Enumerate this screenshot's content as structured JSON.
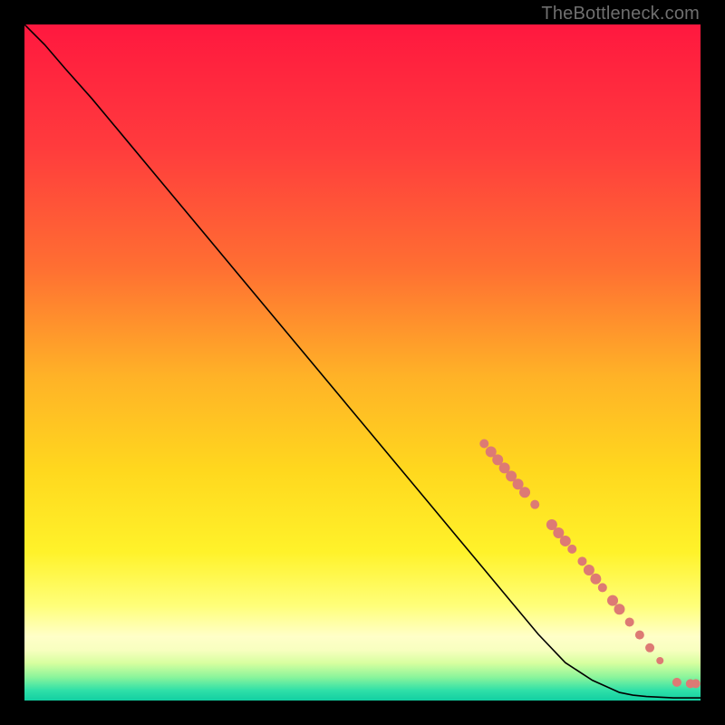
{
  "watermark": "TheBottleneck.com",
  "chart_data": {
    "type": "line",
    "title": "",
    "xlabel": "",
    "ylabel": "",
    "xlim": [
      0,
      100
    ],
    "ylim": [
      0,
      100
    ],
    "grid": false,
    "legend": false,
    "gradient": {
      "description": "vertical multi-stop gradient from red (top) through orange/yellow to pale-yellow then thin green and teal stripes at bottom",
      "stops": [
        {
          "offset": 0.0,
          "color": "#ff183f"
        },
        {
          "offset": 0.18,
          "color": "#ff3b3d"
        },
        {
          "offset": 0.36,
          "color": "#ff6f32"
        },
        {
          "offset": 0.52,
          "color": "#ffb227"
        },
        {
          "offset": 0.66,
          "color": "#ffd81e"
        },
        {
          "offset": 0.78,
          "color": "#fff22a"
        },
        {
          "offset": 0.86,
          "color": "#ffff7a"
        },
        {
          "offset": 0.905,
          "color": "#ffffc8"
        },
        {
          "offset": 0.925,
          "color": "#f8ffc0"
        },
        {
          "offset": 0.945,
          "color": "#d6ff9f"
        },
        {
          "offset": 0.965,
          "color": "#8cf59b"
        },
        {
          "offset": 0.985,
          "color": "#2fe0a8"
        },
        {
          "offset": 1.0,
          "color": "#12cfa2"
        }
      ]
    },
    "series": [
      {
        "name": "curve",
        "kind": "line",
        "color": "#000000",
        "x": [
          0.0,
          3.0,
          6.0,
          10.0,
          15.0,
          20.0,
          30.0,
          40.0,
          50.0,
          60.0,
          68.0,
          72.0,
          76.0,
          80.0,
          84.0,
          88.0,
          90.0,
          92.0,
          94.0,
          96.0,
          97.5,
          100.0
        ],
        "y": [
          100.0,
          97.0,
          93.5,
          89.0,
          83.0,
          77.0,
          65.0,
          53.0,
          41.0,
          29.0,
          19.4,
          14.6,
          9.8,
          5.6,
          3.0,
          1.2,
          0.8,
          0.6,
          0.5,
          0.4,
          0.4,
          0.4
        ]
      },
      {
        "name": "markers",
        "kind": "scatter",
        "color": "#dd7a74",
        "points": [
          {
            "x": 68.0,
            "y": 38.0,
            "r": 5
          },
          {
            "x": 69.0,
            "y": 36.8,
            "r": 6
          },
          {
            "x": 70.0,
            "y": 35.6,
            "r": 6
          },
          {
            "x": 71.0,
            "y": 34.4,
            "r": 6
          },
          {
            "x": 72.0,
            "y": 33.2,
            "r": 6
          },
          {
            "x": 73.0,
            "y": 32.0,
            "r": 6
          },
          {
            "x": 74.0,
            "y": 30.8,
            "r": 6
          },
          {
            "x": 75.5,
            "y": 29.0,
            "r": 5
          },
          {
            "x": 78.0,
            "y": 26.0,
            "r": 6
          },
          {
            "x": 79.0,
            "y": 24.8,
            "r": 6
          },
          {
            "x": 80.0,
            "y": 23.6,
            "r": 6
          },
          {
            "x": 81.0,
            "y": 22.4,
            "r": 5
          },
          {
            "x": 82.5,
            "y": 20.6,
            "r": 5
          },
          {
            "x": 83.5,
            "y": 19.3,
            "r": 6
          },
          {
            "x": 84.5,
            "y": 18.0,
            "r": 6
          },
          {
            "x": 85.5,
            "y": 16.7,
            "r": 5
          },
          {
            "x": 87.0,
            "y": 14.8,
            "r": 6
          },
          {
            "x": 88.0,
            "y": 13.5,
            "r": 6
          },
          {
            "x": 89.5,
            "y": 11.6,
            "r": 5
          },
          {
            "x": 91.0,
            "y": 9.7,
            "r": 5
          },
          {
            "x": 92.5,
            "y": 7.8,
            "r": 5
          },
          {
            "x": 94.0,
            "y": 5.9,
            "r": 4
          },
          {
            "x": 96.5,
            "y": 2.7,
            "r": 5
          },
          {
            "x": 98.5,
            "y": 2.5,
            "r": 5
          },
          {
            "x": 99.3,
            "y": 2.5,
            "r": 5
          }
        ]
      }
    ]
  }
}
